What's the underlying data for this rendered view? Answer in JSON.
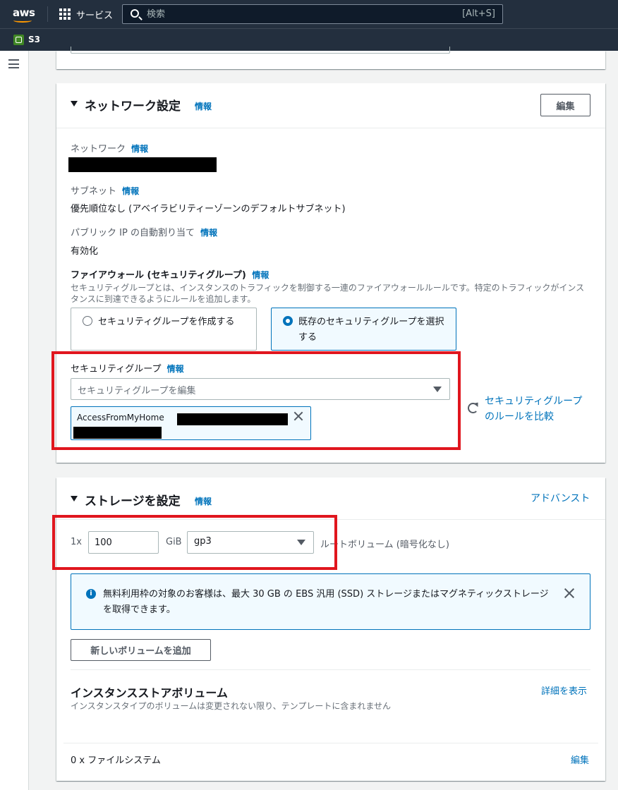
{
  "topnav": {
    "logo": "aws",
    "services_label": "サービス",
    "search_placeholder": "検索",
    "search_shortcut": "[Alt+S]"
  },
  "favorites": {
    "s3_label": "S3"
  },
  "network": {
    "title": "ネットワーク設定",
    "info": "情報",
    "edit_button": "編集",
    "network_label": "ネットワーク",
    "subnet_label": "サブネット",
    "subnet_value": "優先順位なし (アベイラビリティーゾーンのデフォルトサブネット)",
    "public_ip_label": "パブリック IP の自動割り当て",
    "public_ip_value": "有効化",
    "firewall_label": "ファイアウォール (セキュリティグループ)",
    "firewall_desc": "セキュリティグループとは、インスタンスのトラフィックを制御する一連のファイアウォールルールです。特定のトラフィックがインスタンスに到達できるようにルールを追加します。",
    "radio_create": "セキュリティグループを作成する",
    "radio_existing": "既存のセキュリティグループを選択する",
    "selected_radio": "existing",
    "sg_label": "セキュリティグループ",
    "sg_placeholder": "セキュリティグループを編集",
    "sg_token": "AccessFromMyHome",
    "compare_link": "セキュリティグループのルールを比較"
  },
  "storage": {
    "title": "ストレージを設定",
    "info": "情報",
    "advanced_link": "アドバンスト",
    "count_prefix": "1x",
    "size_value": "100",
    "unit": "GiB",
    "volume_type": "gp3",
    "volume_desc": "ルートボリューム (暗号化なし)",
    "alert_text": "無料利用枠の対象のお客様は、最大 30 GB の EBS 汎用 (SSD) ストレージまたはマグネティックストレージを取得できます。",
    "add_volume_button": "新しいボリュームを追加",
    "instance_store_title": "インスタンスストアボリューム",
    "instance_store_desc": "インスタンスタイプのボリュームは変更されない限り、テンプレートに含まれません",
    "show_details_link": "詳細を表示",
    "fs_label": "0 x ファイルシステム",
    "fs_edit_link": "編集"
  },
  "colors": {
    "nav_bg": "#232f3e",
    "link": "#0073bb",
    "highlight": "#e0161e"
  }
}
